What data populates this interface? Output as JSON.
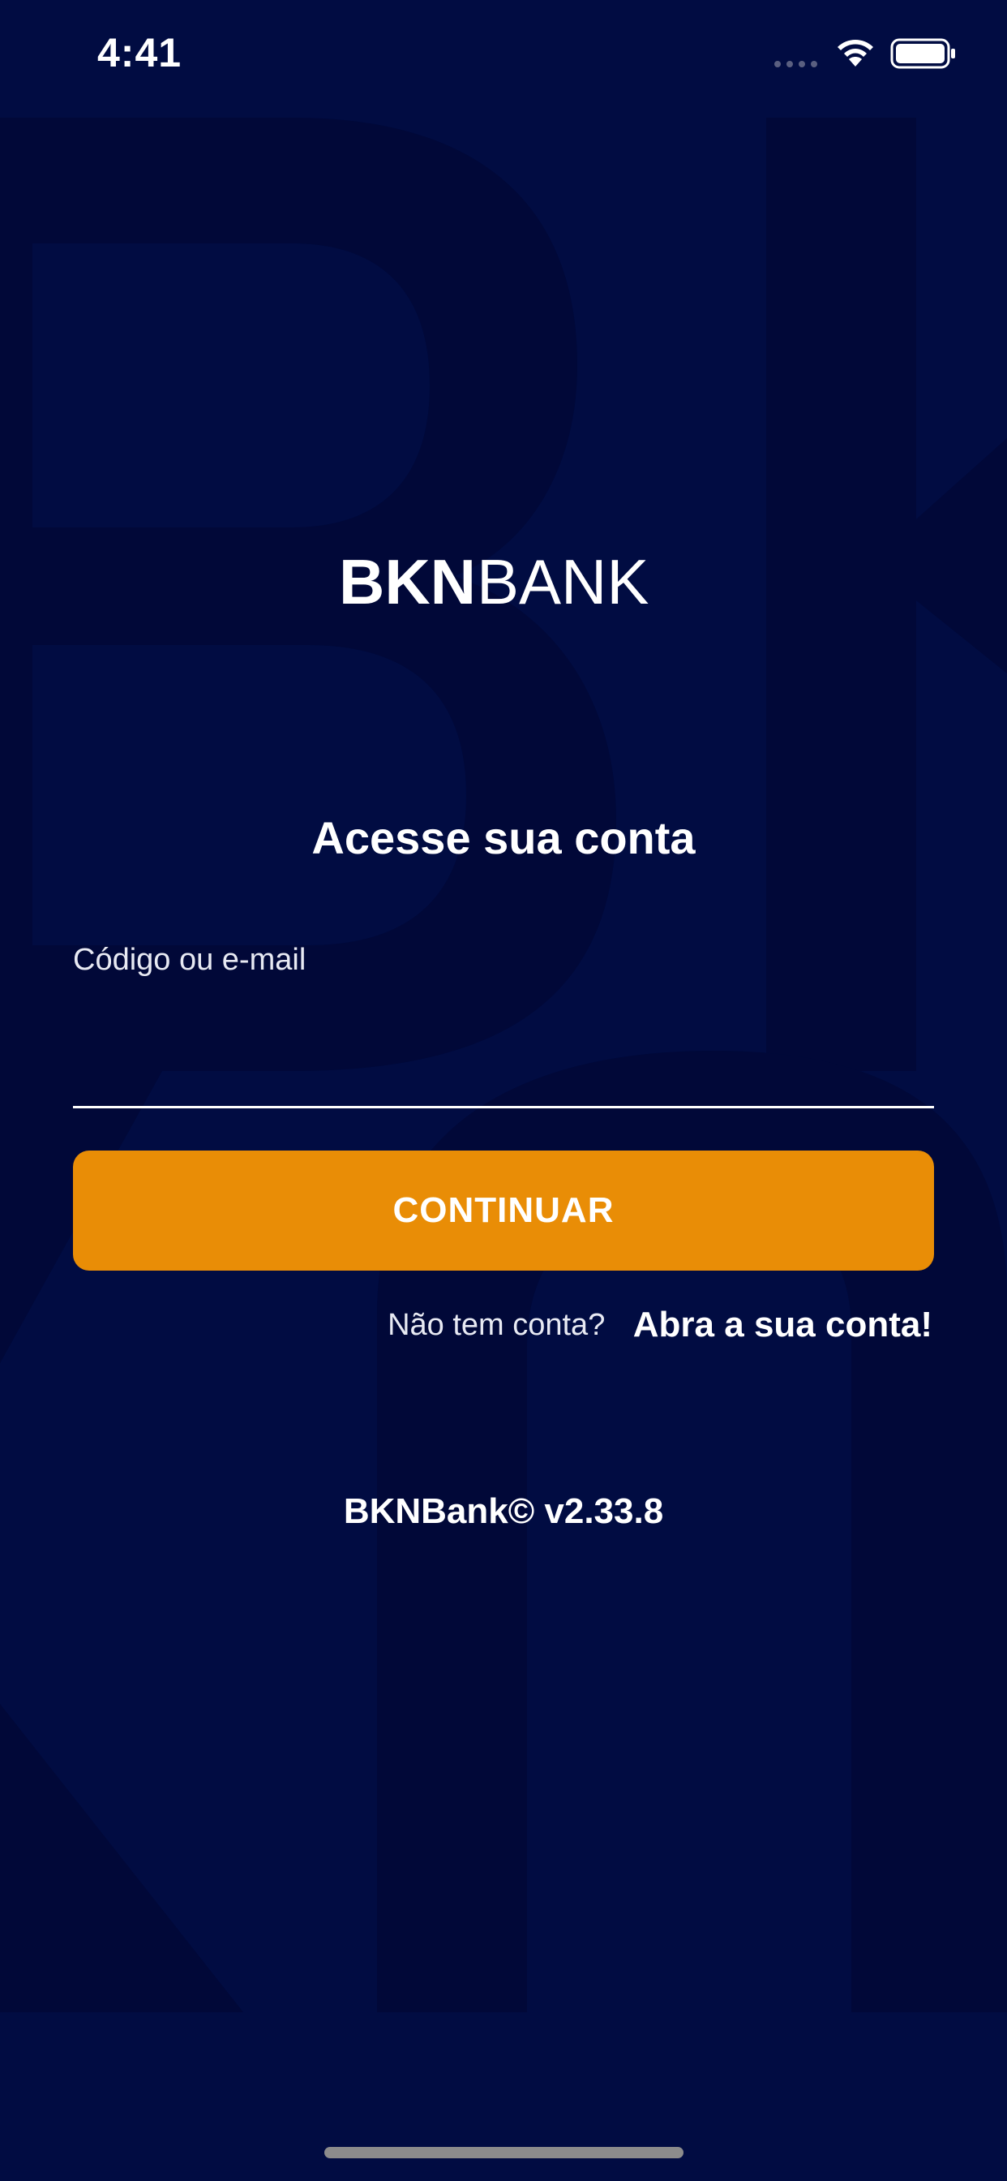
{
  "status_bar": {
    "time": "4:41",
    "signal_icon": "cellular-signal-icon",
    "wifi_icon": "wifi-icon",
    "battery_icon": "battery-icon"
  },
  "logo": {
    "text_bold": "BKN",
    "text_light": "BANK",
    "icon": "bknbank-logo"
  },
  "login": {
    "title": "Acesse sua conta",
    "field_label": "Código ou e-mail",
    "field_value": "",
    "continue_label": "CONTINUAR",
    "no_account_text": "Não tem conta?",
    "open_account_link": "Abra a sua conta!"
  },
  "footer": {
    "version": "BKNBank© v2.33.8"
  },
  "colors": {
    "background": "#010c42",
    "background_letters": "#010838",
    "accent": "#e98d06",
    "text": "#ffffff"
  }
}
